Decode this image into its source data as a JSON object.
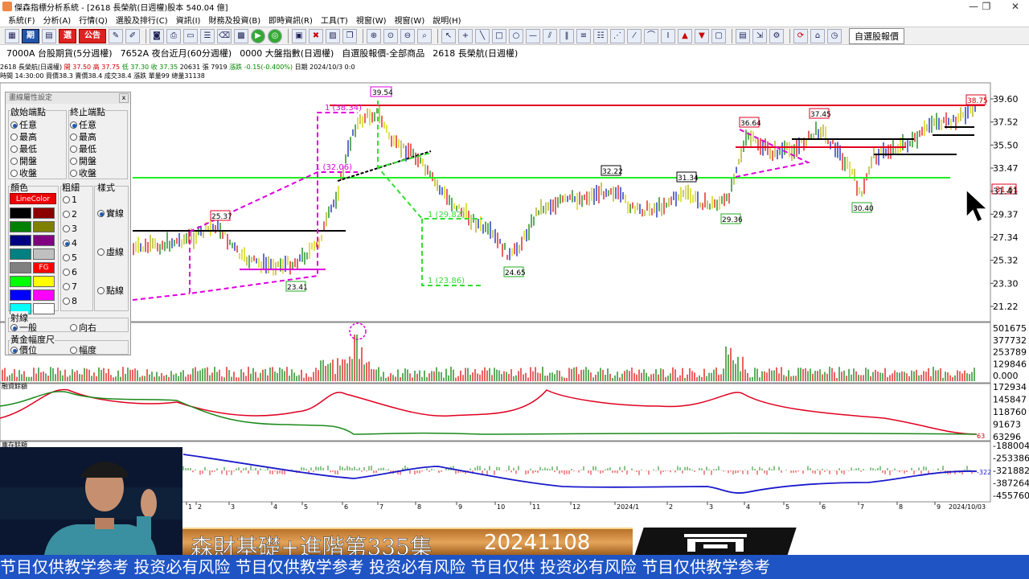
{
  "window": {
    "title": "傑森指標分析系統 - [2618 長榮航(日週權)股本 540.04 億]",
    "minimize": "—",
    "maximize": "❐",
    "close": "✕"
  },
  "menu": [
    "系統(F)",
    "分析(A)",
    "行情(Q)",
    "選股及排行(C)",
    "資訊(I)",
    "財務及投資(B)",
    "即時資訊(R)",
    "工具(T)",
    "視窗(W)",
    "視窗(W)",
    "說明(H)"
  ],
  "toolbar": {
    "b1": "期",
    "b2": "選",
    "b3": "公告",
    "quote_button": "自選股報價",
    "icons": [
      "chart-icon",
      "table-icon",
      "print-icon",
      "save-icon",
      "zoom-in-icon",
      "zoom-out-icon",
      "cursor-icon",
      "crosshair-icon",
      "line-icon",
      "rect-icon",
      "circle-icon",
      "hline-icon",
      "fib-icon",
      "text-icon",
      "refresh-icon",
      "home-icon"
    ]
  },
  "tabs": [
    "7000A 台股期貨(5分週權)",
    "7652A 夜台近月(60分週權)",
    "0000 大盤指數(日週權)",
    "自選股報價-全部商品",
    "2618 長榮航(日週權)"
  ],
  "quote": {
    "line1": [
      "2618 長榮航(日週權)",
      "開 37.50",
      "高 37.75",
      "低 37.30",
      "收 37.35",
      "20631",
      "張",
      "7919",
      "漲跌 -0.15(-0.400%)",
      "日期 2024/10/3 0:0"
    ],
    "line2": [
      "時間 14:30:00",
      "買價38.3",
      "賣價38.4",
      "成交38.4",
      "漲跌",
      "單量99",
      "總量31138"
    ]
  },
  "chart_data": {
    "type": "candlestick",
    "symbol": "2618 長榮航(日週權)",
    "price_axis": [
      "39.60",
      "37.52",
      "35.50",
      "33.47",
      "31.41",
      "29.37",
      "27.34",
      "25.32",
      "23.30",
      "21.22"
    ],
    "price_current_tag": "31.61",
    "price_last_tag": "38.75",
    "volume_axis": [
      "501675",
      "377732",
      "253789",
      "129846",
      "0.000"
    ],
    "ind1_axis": [
      "172934",
      "145847",
      "118760",
      "91673",
      "63296"
    ],
    "ind2_axis": [
      "-188004",
      "-253386",
      "-321882",
      "-387264",
      "-455760"
    ],
    "ind2_tag": "-322",
    "x_ticks": [
      "1",
      "2",
      "3",
      "4",
      "5",
      "6",
      "7",
      "8",
      "9",
      "10",
      "11",
      "12",
      "2024/1",
      "2",
      "3",
      "4",
      "5",
      "6",
      "7",
      "8",
      "9",
      "10",
      "2024/10/03"
    ],
    "price_labels": [
      "39.54",
      "37.45",
      "36.64",
      "32.22",
      "31.34",
      "29.36",
      "30.40",
      "24.65",
      "23.41",
      "25.37"
    ],
    "fib_labels": [
      "1 (38.34)",
      "1 (32.06)",
      "1 (29.82)",
      "1 (23.86)"
    ],
    "panel_labels": [
      "融資餘額",
      "庫存餘額"
    ],
    "peak_label": "39.54"
  },
  "panel": {
    "title": "畫線屬性設定",
    "close": "x",
    "start_title": "啟始端點",
    "end_title": "終止端點",
    "start_opts": [
      "任意",
      "最高",
      "最低",
      "開盤",
      "收盤"
    ],
    "end_opts": [
      "任意",
      "最高",
      "最低",
      "開盤",
      "收盤"
    ],
    "color_title": "顏色",
    "width_title": "粗細",
    "style_title": "樣式",
    "linecolor": "LineColor",
    "fg": "FG",
    "widths": [
      "1",
      "2",
      "3",
      "4",
      "5",
      "6",
      "7",
      "8"
    ],
    "styles": [
      "實線",
      "虛線",
      "點線"
    ],
    "ray_title": "射線",
    "ray_opts": [
      "一般",
      "向右"
    ],
    "gold_title": "黃金幅度尺",
    "gold_opts": [
      "價位",
      "幅度"
    ],
    "colors": [
      "#000000",
      "#8b0000",
      "#008000",
      "#808000",
      "#000080",
      "#800080",
      "#008080",
      "#c0c0c0",
      "#808080",
      "#ff0000",
      "#00ff00",
      "#ffff00",
      "#0000ff",
      "#ff00ff",
      "#00ffff",
      "#ffffff"
    ]
  },
  "video": {
    "title": "森財基礎+進階第335集",
    "date": "20241108",
    "ticker": "节目仅供教学参考  投资必有风险  节目仅供教学参考  投资必有风险  节目仅供  投资必有风险  节目仅供教学参考"
  }
}
